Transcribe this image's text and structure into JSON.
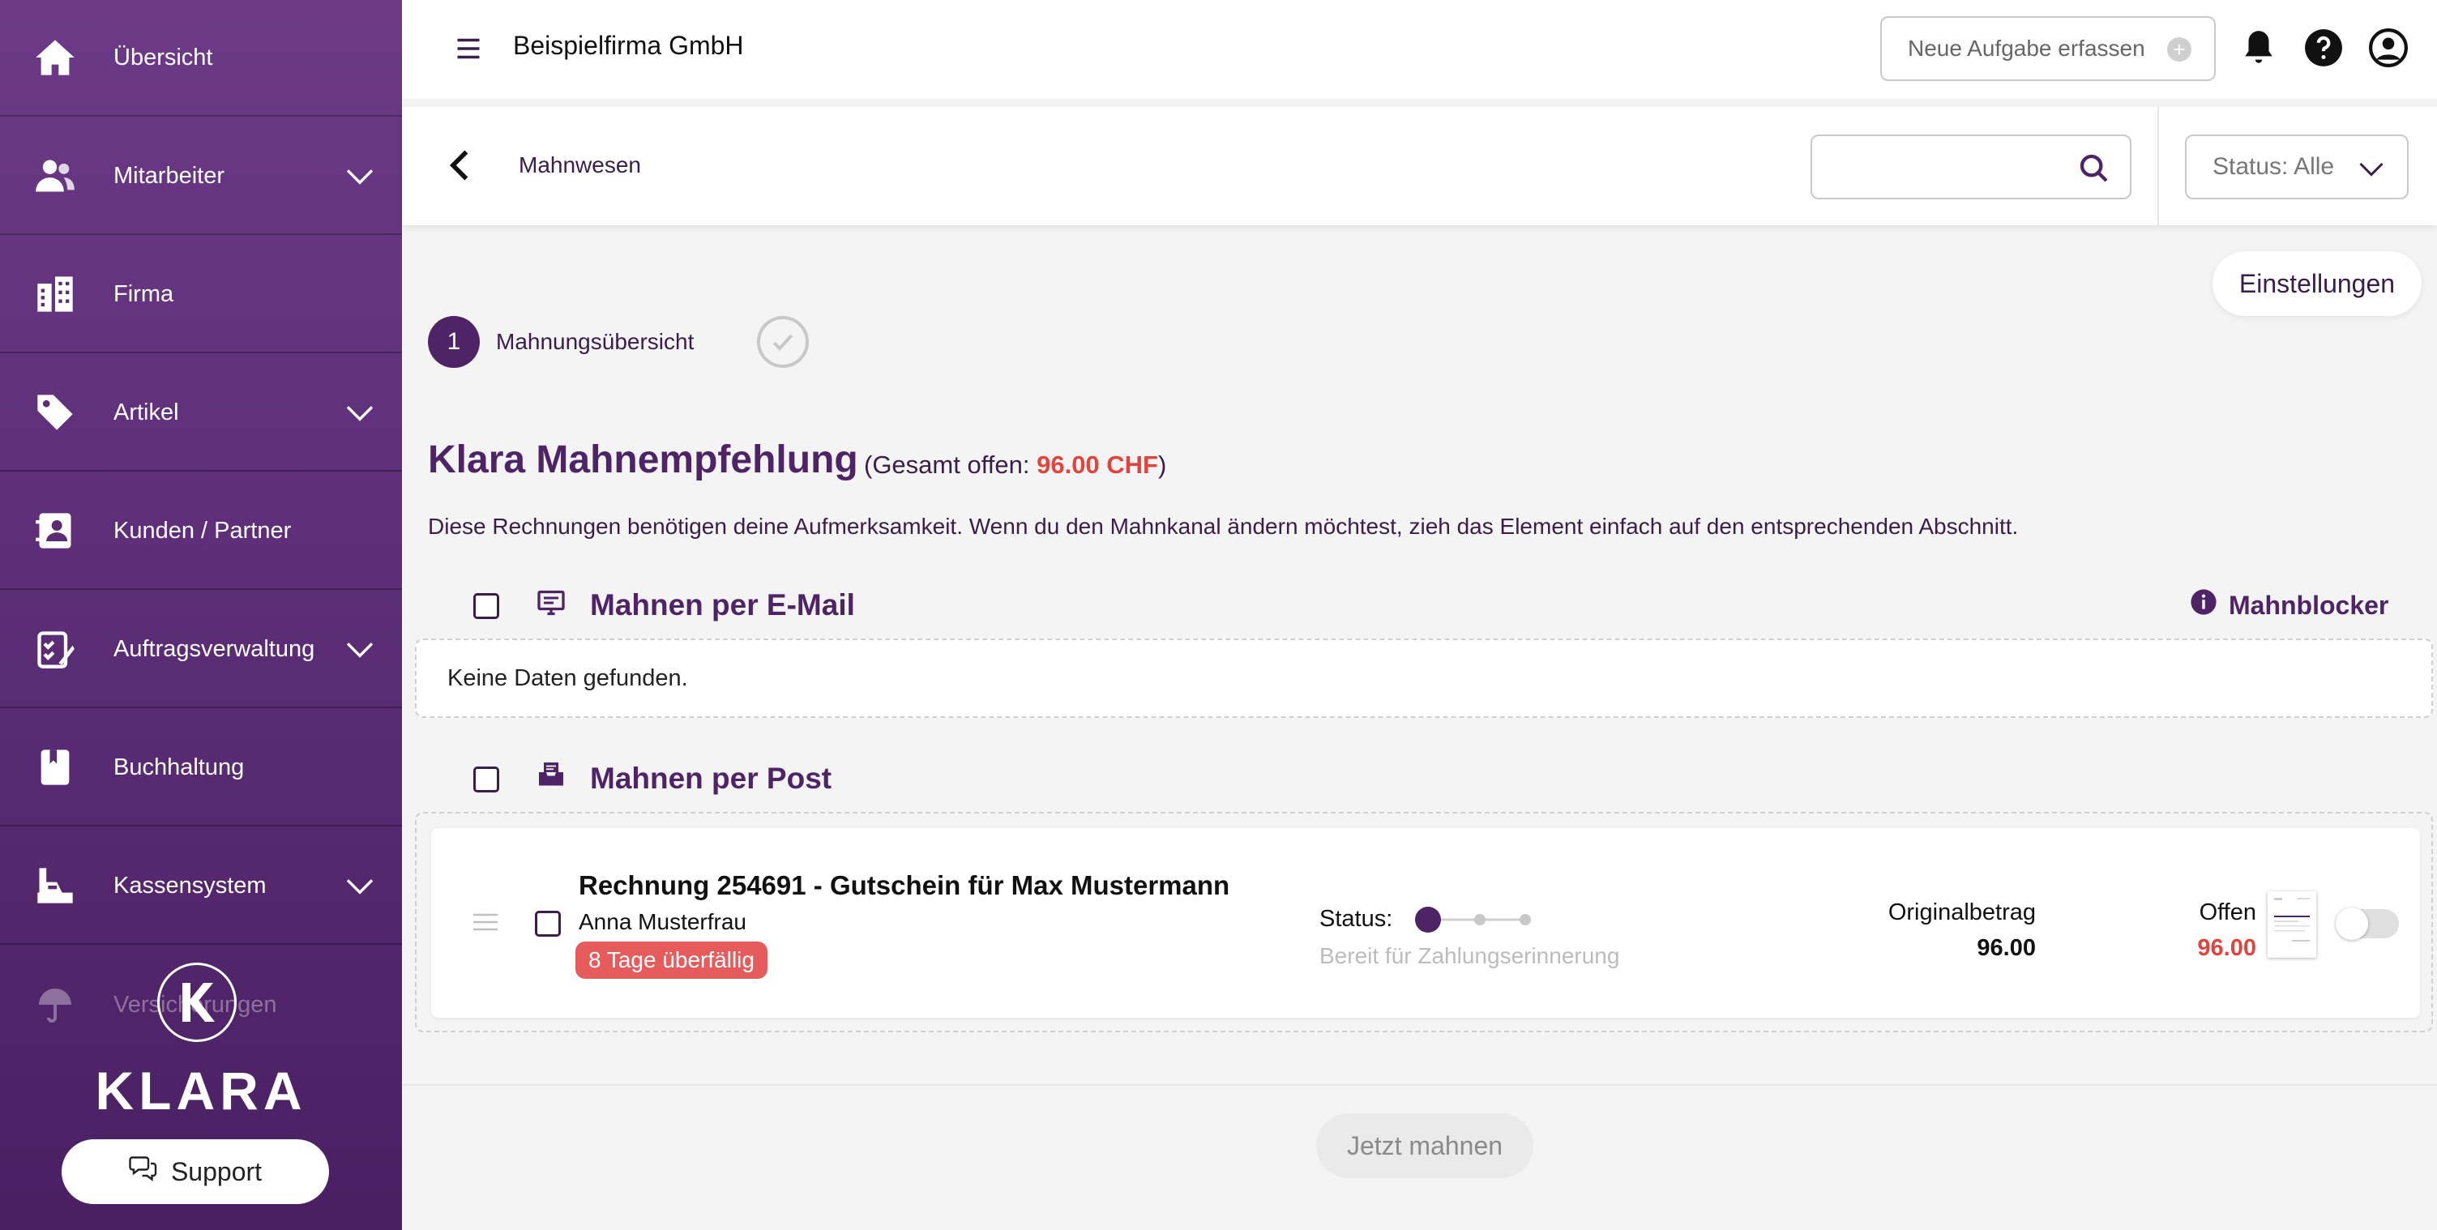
{
  "sidebar": {
    "items": [
      {
        "label": "Übersicht",
        "icon": "home-icon"
      },
      {
        "label": "Mitarbeiter",
        "icon": "users-icon"
      },
      {
        "label": "Firma",
        "icon": "building-icon"
      },
      {
        "label": "Artikel",
        "icon": "tag-icon"
      },
      {
        "label": "Kunden / Partner",
        "icon": "contacts-icon"
      },
      {
        "label": "Auftragsverwaltung",
        "icon": "clipboard-icon"
      },
      {
        "label": "Buchhaltung",
        "icon": "book-icon"
      },
      {
        "label": "Kassensystem",
        "icon": "cash-register-icon"
      },
      {
        "label": "Versicherungen",
        "icon": "umbrella-icon"
      }
    ],
    "logo_text": "KLARA",
    "support_label": "Support"
  },
  "topbar": {
    "company": "Beispielfirma GmbH",
    "new_task_label": "Neue Aufgabe erfassen"
  },
  "subbar": {
    "breadcrumb": "Mahnwesen",
    "search_value": "",
    "status_filter": "Status: Alle"
  },
  "main": {
    "settings_label": "Einstellungen",
    "step": {
      "number": "1",
      "label": "Mahnungsübersicht"
    },
    "headline": "Klara Mahnempfehlung",
    "total_prefix": "(Gesamt offen: ",
    "total_amount": "96.00 CHF",
    "total_suffix": ")",
    "description": "Diese Rechnungen benötigen deine Aufmerksamkeit. Wenn du den Mahnkanal ändern möchtest, zieh das Element einfach auf den entsprechenden Abschnitt.",
    "mahnblocker_label": "Mahnblocker",
    "email_section": {
      "title": "Mahnen per E-Mail",
      "empty_text": "Keine Daten gefunden."
    },
    "post_section": {
      "title": "Mahnen per Post",
      "invoice": {
        "title": "Rechnung 254691 - Gutschein für Max Mustermann",
        "customer": "Anna Musterfrau",
        "overdue": "8 Tage überfällig",
        "status_label": "Status:",
        "status_text": "Bereit für Zahlungserinnerung",
        "status_step": 1,
        "status_steps_total": 3,
        "original_label": "Originalbetrag",
        "original_amount": "96.00",
        "open_label": "Offen",
        "open_amount": "96.00",
        "toggle_on": false
      }
    },
    "action_label": "Jetzt mahnen"
  },
  "colors": {
    "sidebar": "#5a2c74",
    "accent": "#4e2466",
    "danger": "#e0443c",
    "overdue_badge": "#e65c5c"
  }
}
